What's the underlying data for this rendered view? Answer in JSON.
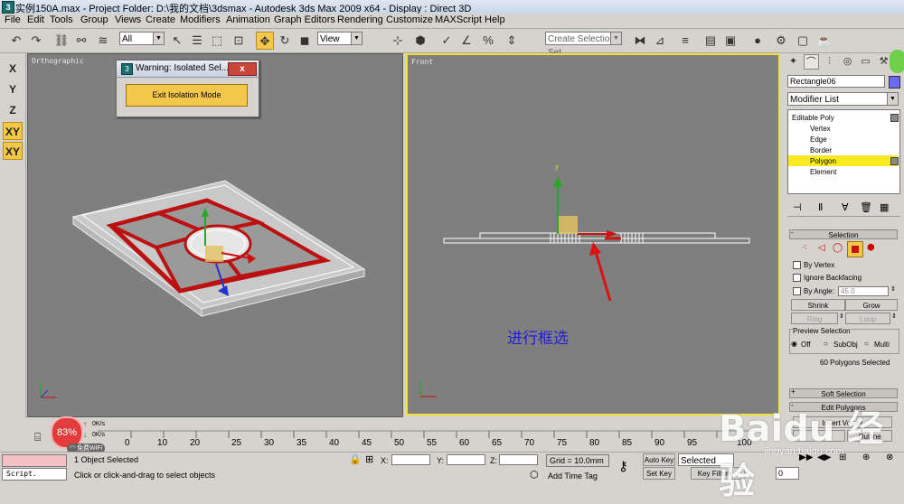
{
  "window": {
    "title": "实例150A.max    - Project Folder: D:\\我的文档\\3dsmax    - Autodesk 3ds Max  2009 x64      - Display : Direct 3D"
  },
  "menu": [
    "File",
    "Edit",
    "Tools",
    "Group",
    "Views",
    "Create",
    "Modifiers",
    "Animation",
    "Graph Editors",
    "Rendering",
    "Customize",
    "MAXScript",
    "Help"
  ],
  "toolbar": {
    "selection_filter": "All",
    "ref_coord": "View",
    "named_selection_placeholder": "Create Selection Set"
  },
  "axis_constraints": [
    "X",
    "Y",
    "Z",
    "XY",
    "XY"
  ],
  "viewports": {
    "left_label": "Orthographic",
    "right_label": "Front",
    "annotation": "进行框选"
  },
  "dialog": {
    "title": "Warning: Isolated Sel...",
    "close": "x",
    "button": "Exit Isolation Mode"
  },
  "command_panel": {
    "object_name": "Rectangle06",
    "object_color": "#6a6af0",
    "modifier_list": "Modifier List",
    "stack": [
      "Editable Poly",
      "Vertex",
      "Edge",
      "Border",
      "Polygon",
      "Element"
    ],
    "selection_rollout": "Selection",
    "by_vertex": "By Vertex",
    "ignore_backfacing": "Ignore Backfacing",
    "by_angle": "By Angle:",
    "by_angle_value": "45.0",
    "shrink": "Shrink",
    "grow": "Grow",
    "ring": "Ring",
    "loop": "Loop",
    "preview_selection": "Preview Selection",
    "preview_options": [
      "Off",
      "SubObj",
      "Multi"
    ],
    "selection_status": "60 Polygons Selected",
    "soft_selection": "Soft Selection",
    "edit_polygons": "Edit Polygons",
    "insert_vertex": "Insert Vertex",
    "outline": "Outline"
  },
  "timeline": {
    "ticks": [
      "0",
      "10",
      "20",
      "25",
      "30",
      "35",
      "40",
      "45",
      "50",
      "55",
      "60",
      "65",
      "70",
      "75",
      "80",
      "85",
      "90",
      "95",
      "100"
    ],
    "progress_value": "83%",
    "net_up": "0K/s",
    "net_down": "0K/s",
    "wifi_label": "免费WiFi"
  },
  "status": {
    "script_label": "Script.",
    "objects_selected": "1 Object Selected",
    "prompt": "Click or click-and-drag to select objects",
    "x_label": "X:",
    "y_label": "Y:",
    "z_label": "Z:",
    "grid": "Grid = 10.0mm",
    "add_time_tag": "Add Time Tag",
    "auto_key": "Auto Key",
    "set_key": "Set Key",
    "selected": "Selected",
    "key_filters": "Key Filters...",
    "frame": "0"
  },
  "watermark": {
    "text": "Baidu 经验",
    "url": "jingyan.baidu.com"
  }
}
